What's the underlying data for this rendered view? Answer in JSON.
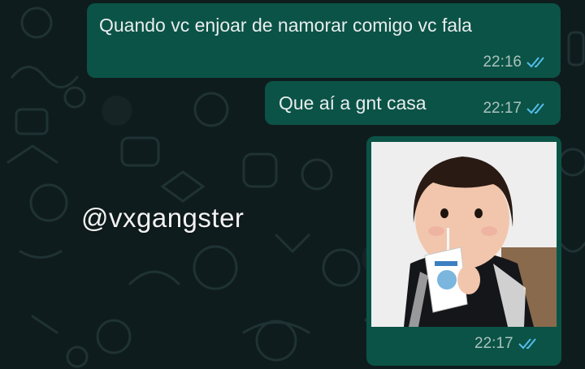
{
  "watermark": "@vxgangster",
  "messages": [
    {
      "text": "Quando vc enjoar de namorar comigo vc fala",
      "time": "22:16",
      "status": "read"
    },
    {
      "text": "Que aí a gnt casa",
      "time": "22:17",
      "status": "read"
    },
    {
      "image": "toddler-drinking-milk-carton",
      "time": "22:17",
      "status": "read"
    }
  ],
  "colors": {
    "background": "#0f1c1e",
    "outgoing_bubble": "#0b5346",
    "read_ticks": "#53bdeb",
    "time_text": "#a9c3bd"
  },
  "icons": [
    "double-check-icon"
  ]
}
